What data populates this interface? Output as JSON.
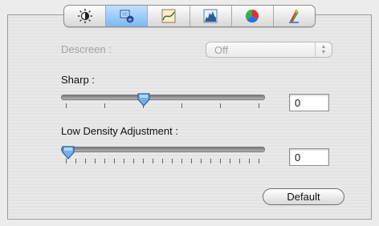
{
  "tabs": [
    {
      "name": "brightness-contrast-icon",
      "selected": false
    },
    {
      "name": "sharpness-icon",
      "selected": true
    },
    {
      "name": "tone-curve-icon",
      "selected": false
    },
    {
      "name": "histogram-icon",
      "selected": false
    },
    {
      "name": "color-balance-icon",
      "selected": false
    },
    {
      "name": "color-picker-icon",
      "selected": false
    }
  ],
  "descreen": {
    "label": "Descreen :",
    "value": "Off",
    "enabled": false
  },
  "sharp": {
    "label": "Sharp :",
    "value": "0",
    "slider_position": 0.4
  },
  "low_density": {
    "label": "Low Density Adjustment :",
    "value": "0",
    "slider_position": 0.0
  },
  "default_button": "Default",
  "colors": {
    "accent": "#5fa8f0",
    "disabled_text": "#a2a2a2"
  }
}
